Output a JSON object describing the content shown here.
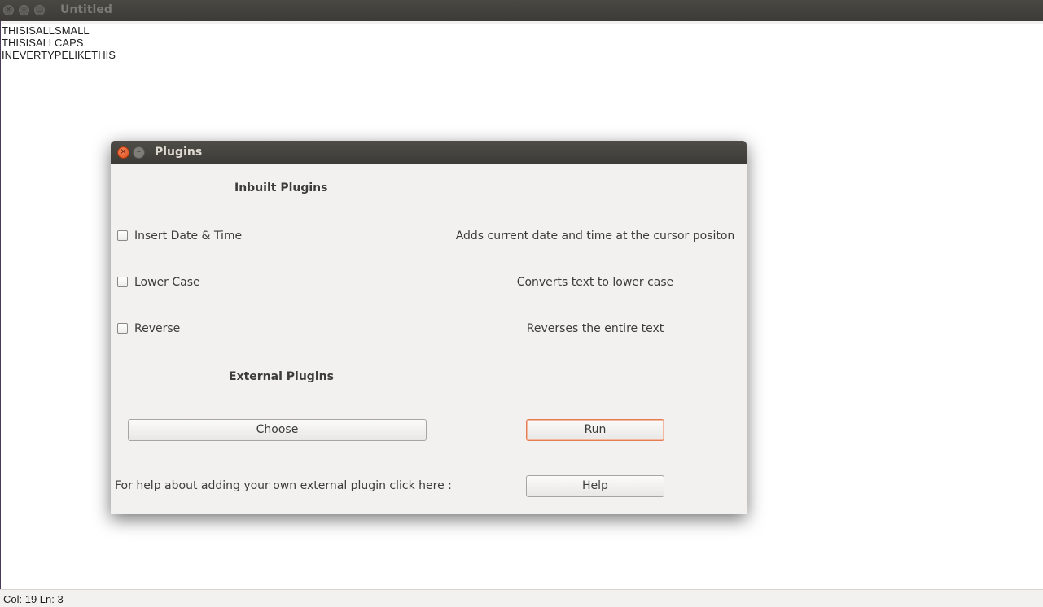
{
  "main_window": {
    "title": "Untitled",
    "controls": {
      "close_glyph": "×",
      "minimize_glyph": "–",
      "maximize_glyph": "□"
    }
  },
  "editor": {
    "lines": [
      "THISISALLSMALL",
      "THISISALLCAPS",
      "INEVERTYPELIKETHIS"
    ]
  },
  "statusbar": {
    "text": "Col: 19 Ln: 3"
  },
  "dialog": {
    "title": "Plugins",
    "close_glyph": "×",
    "minimize_glyph": "–",
    "inbuilt_heading": "Inbuilt Plugins",
    "external_heading": "External Plugins",
    "plugins": [
      {
        "label": "Insert Date & Time",
        "description": "Adds current date and time at the cursor positon",
        "checked": false
      },
      {
        "label": "Lower Case",
        "description": "Converts text to lower case",
        "checked": false
      },
      {
        "label": "Reverse",
        "description": "Reverses the entire text",
        "checked": false
      }
    ],
    "choose_label": "Choose",
    "run_label": "Run",
    "help_text": "For help about adding your own external plugin click here :",
    "help_label": "Help"
  },
  "colors": {
    "titlebar": "#3c3b37",
    "close_button": "#df4a16",
    "dialog_bg": "#f2f1f0",
    "run_focus": "#e57d53"
  }
}
